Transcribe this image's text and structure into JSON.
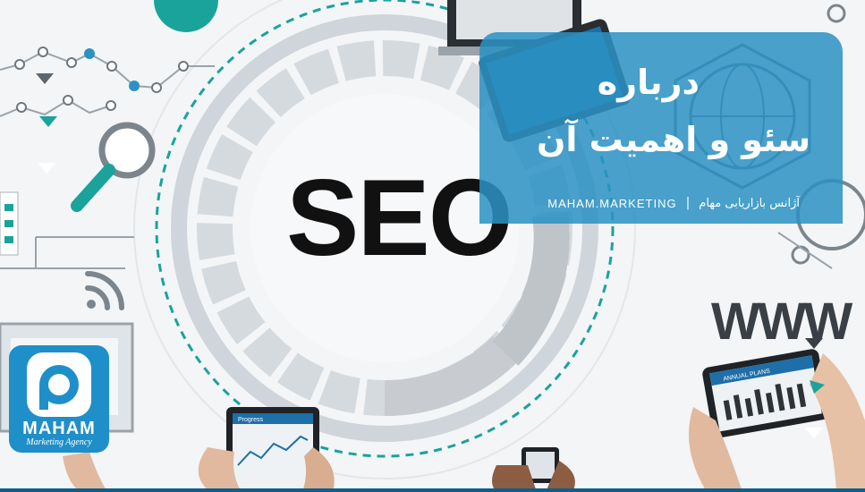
{
  "image": {
    "center_word": "SEO",
    "www_text": "WWW"
  },
  "card": {
    "title_line1": "درباره",
    "title_line2": "سئو و اهمیت آن",
    "site": "MAHAM.MARKETING",
    "separator": "|",
    "agency": "آژانس بازاریابی مهام"
  },
  "logo": {
    "name": "MAHAM",
    "tagline": "Marketing Agency"
  },
  "tablet": {
    "plans_label": "ANNUAL PLANS",
    "progress_label": "Progress"
  },
  "colors": {
    "card": "#2b92c4",
    "accent_teal": "#1aa39a",
    "logo": "#1f8fc9",
    "text_dark": "#111111"
  }
}
